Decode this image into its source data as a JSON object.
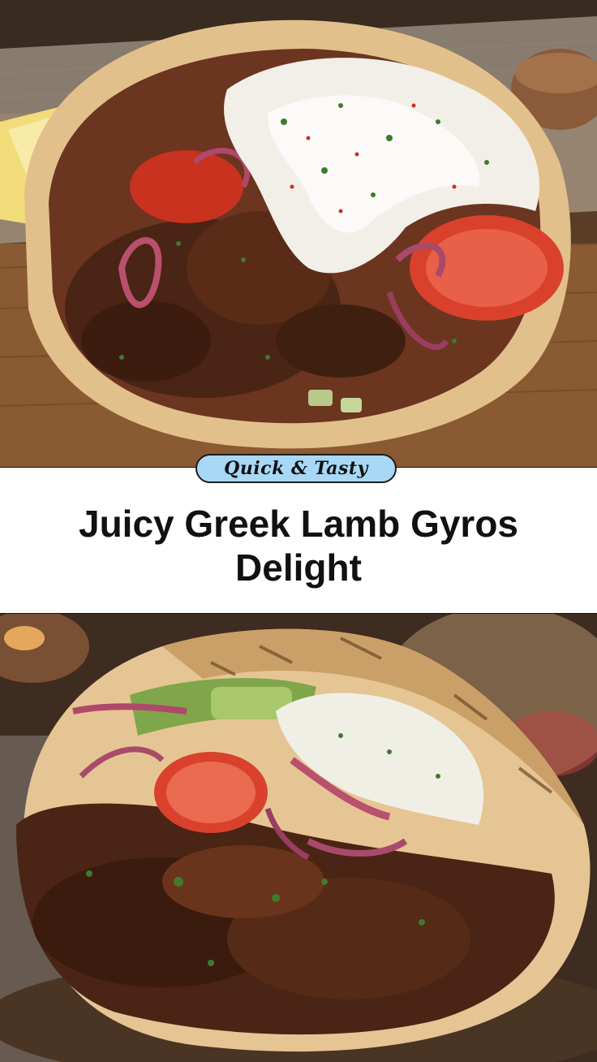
{
  "badge": {
    "label": "Quick & Tasty",
    "color": "#a9d8f6"
  },
  "title": {
    "line1": "Juicy Greek Lamb Gyros",
    "line2": "Delight"
  },
  "photos": {
    "top": "lamb-gyro-pita-with-tzatziki-photo",
    "bottom": "lamb-gyro-pita-closeup-photo"
  }
}
